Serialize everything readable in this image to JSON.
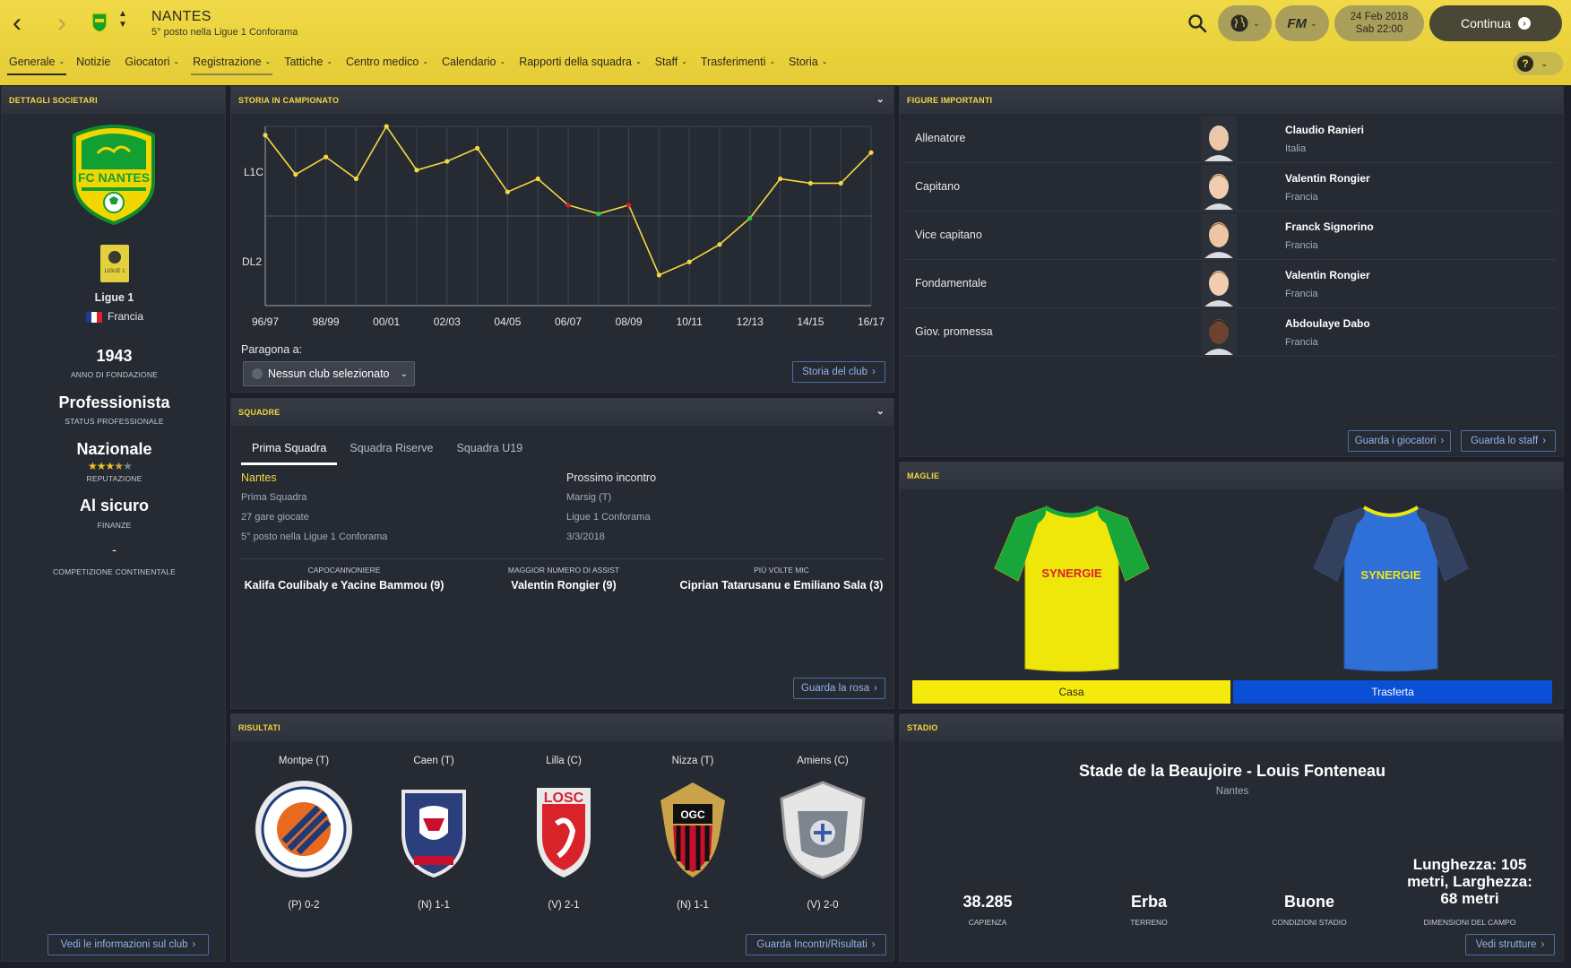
{
  "header": {
    "club_name": "NANTES",
    "club_subtitle": "5° posto nella Ligue 1 Conforama",
    "date": "24 Feb 2018",
    "time": "Sab 22:00",
    "continue_label": "Continua"
  },
  "menu": [
    {
      "label": "Generale",
      "chevron": true
    },
    {
      "label": "Notizie",
      "chevron": false
    },
    {
      "label": "Giocatori",
      "chevron": true
    },
    {
      "label": "Registrazione",
      "chevron": true
    },
    {
      "label": "Tattiche",
      "chevron": true
    },
    {
      "label": "Centro medico",
      "chevron": true
    },
    {
      "label": "Calendario",
      "chevron": true
    },
    {
      "label": "Rapporti della squadra",
      "chevron": true
    },
    {
      "label": "Staff",
      "chevron": true
    },
    {
      "label": "Trasferimenti",
      "chevron": true
    },
    {
      "label": "Storia",
      "chevron": true
    }
  ],
  "club_details": {
    "title": "DETTAGLI SOCIETARI",
    "crest_text": "FC NANTES",
    "league": "Ligue 1",
    "country": "Francia",
    "founded": "1943",
    "founded_label": "ANNO DI FONDAZIONE",
    "status": "Professionista",
    "status_label": "STATUS PROFESSIONALE",
    "reputation": "Nazionale",
    "reputation_stars": 3.5,
    "reputation_label": "REPUTAZIONE",
    "finances": "Al sicuro",
    "finances_label": "FINANZE",
    "continental": "-",
    "continental_label": "COMPETIZIONE CONTINENTALE",
    "button": "Vedi le informazioni sul club"
  },
  "history": {
    "title": "STORIA IN CAMPIONATO",
    "compare_label": "Paragona a:",
    "compare_value": "Nessun club selezionato",
    "button": "Storia del club"
  },
  "chart_data": {
    "type": "line",
    "y_labels": [
      "L1C",
      "DL2"
    ],
    "x": [
      "96/97",
      "97/98",
      "98/99",
      "99/00",
      "00/01",
      "01/02",
      "02/03",
      "03/04",
      "04/05",
      "05/06",
      "06/07",
      "07/08",
      "08/09",
      "09/10",
      "10/11",
      "11/12",
      "12/13",
      "13/14",
      "14/15",
      "15/16",
      "16/17"
    ],
    "x_tick_labels": [
      "96/97",
      "98/99",
      "00/01",
      "02/03",
      "04/05",
      "06/07",
      "08/09",
      "10/11",
      "12/13",
      "14/15",
      "16/17"
    ],
    "ylim": [
      41,
      0
    ],
    "series": [
      {
        "values": [
          2,
          11,
          7,
          12,
          0,
          10,
          8,
          5,
          15,
          12,
          18,
          20,
          18,
          34,
          31,
          27,
          21,
          12,
          13,
          13,
          6
        ]
      }
    ],
    "markers": [
      {
        "x": "06/07",
        "color": "#e02020"
      },
      {
        "x": "07/08",
        "color": "#20d040"
      },
      {
        "x": "08/09",
        "color": "#e02020"
      },
      {
        "x": "12/13",
        "color": "#20d040"
      }
    ]
  },
  "teams": {
    "title": "SQUADRE",
    "tabs": [
      "Prima Squadra",
      "Squadra Riserve",
      "Squadra U19"
    ],
    "team_name": "Nantes",
    "team_lines": [
      "Prima Squadra",
      "27 gare giocate",
      "5° posto nella Ligue 1 Conforama"
    ],
    "next_title": "Prossimo incontro",
    "next_lines": [
      "Marsig (T)",
      "Ligue 1 Conforama",
      "3/3/2018"
    ],
    "stats": [
      {
        "label": "CAPOCANNONIERE",
        "value": "Kalifa Coulibaly e Yacine Bammou (9)"
      },
      {
        "label": "MAGGIOR NUMERO DI ASSIST",
        "value": "Valentin Rongier (9)"
      },
      {
        "label": "PIÙ VOLTE MIC",
        "value": "Ciprian Tatarusanu e Emiliano Sala (3)"
      }
    ],
    "button": "Guarda la rosa"
  },
  "results": {
    "title": "RISULTATI",
    "items": [
      {
        "opponent": "Montpe (T)",
        "score": "(P) 0-2",
        "crest": "montpellier"
      },
      {
        "opponent": "Caen (T)",
        "score": "(N) 1-1",
        "crest": "caen"
      },
      {
        "opponent": "Lilla (C)",
        "score": "(V) 2-1",
        "crest": "lille",
        "crest_text": "LOSC"
      },
      {
        "opponent": "Nizza (T)",
        "score": "(N) 1-1",
        "crest": "nice",
        "crest_text": "OGC NICE"
      },
      {
        "opponent": "Amiens (C)",
        "score": "(V) 2-0",
        "crest": "amiens"
      }
    ],
    "button": "Guarda Incontri/Risultati"
  },
  "figures": {
    "title": "FIGURE IMPORTANTI",
    "rows": [
      {
        "role": "Allenatore",
        "name": "Claudio Ranieri",
        "nation": "Italia"
      },
      {
        "role": "Capitano",
        "name": "Valentin Rongier",
        "nation": "Francia"
      },
      {
        "role": "Vice capitano",
        "name": "Franck Signorino",
        "nation": "Francia"
      },
      {
        "role": "Fondamentale",
        "name": "Valentin Rongier",
        "nation": "Francia"
      },
      {
        "role": "Giov. promessa",
        "name": "Abdoulaye Dabo",
        "nation": "Francia"
      }
    ],
    "btn_players": "Guarda i giocatori",
    "btn_staff": "Guarda lo staff"
  },
  "kits": {
    "title": "MAGLIE",
    "home_label": "Casa",
    "away_label": "Trasferta",
    "sponsor": "SYNERGIE",
    "home_color": "#f5ea0c",
    "away_color": "#0a4fd6"
  },
  "stadium": {
    "title": "STADIO",
    "name": "Stade de la Beaujoire - Louis Fonteneau",
    "city": "Nantes",
    "stats": [
      {
        "value": "38.285",
        "label": "CAPIENZA"
      },
      {
        "value": "Erba",
        "label": "TERRENO"
      },
      {
        "value": "Buone",
        "label": "CONDIZIONI STADIO"
      },
      {
        "value": "Lunghezza: 105 metri, Larghezza: 68 metri",
        "label": "DIMENSIONI DEL CAMPO"
      }
    ],
    "button": "Vedi strutture"
  }
}
